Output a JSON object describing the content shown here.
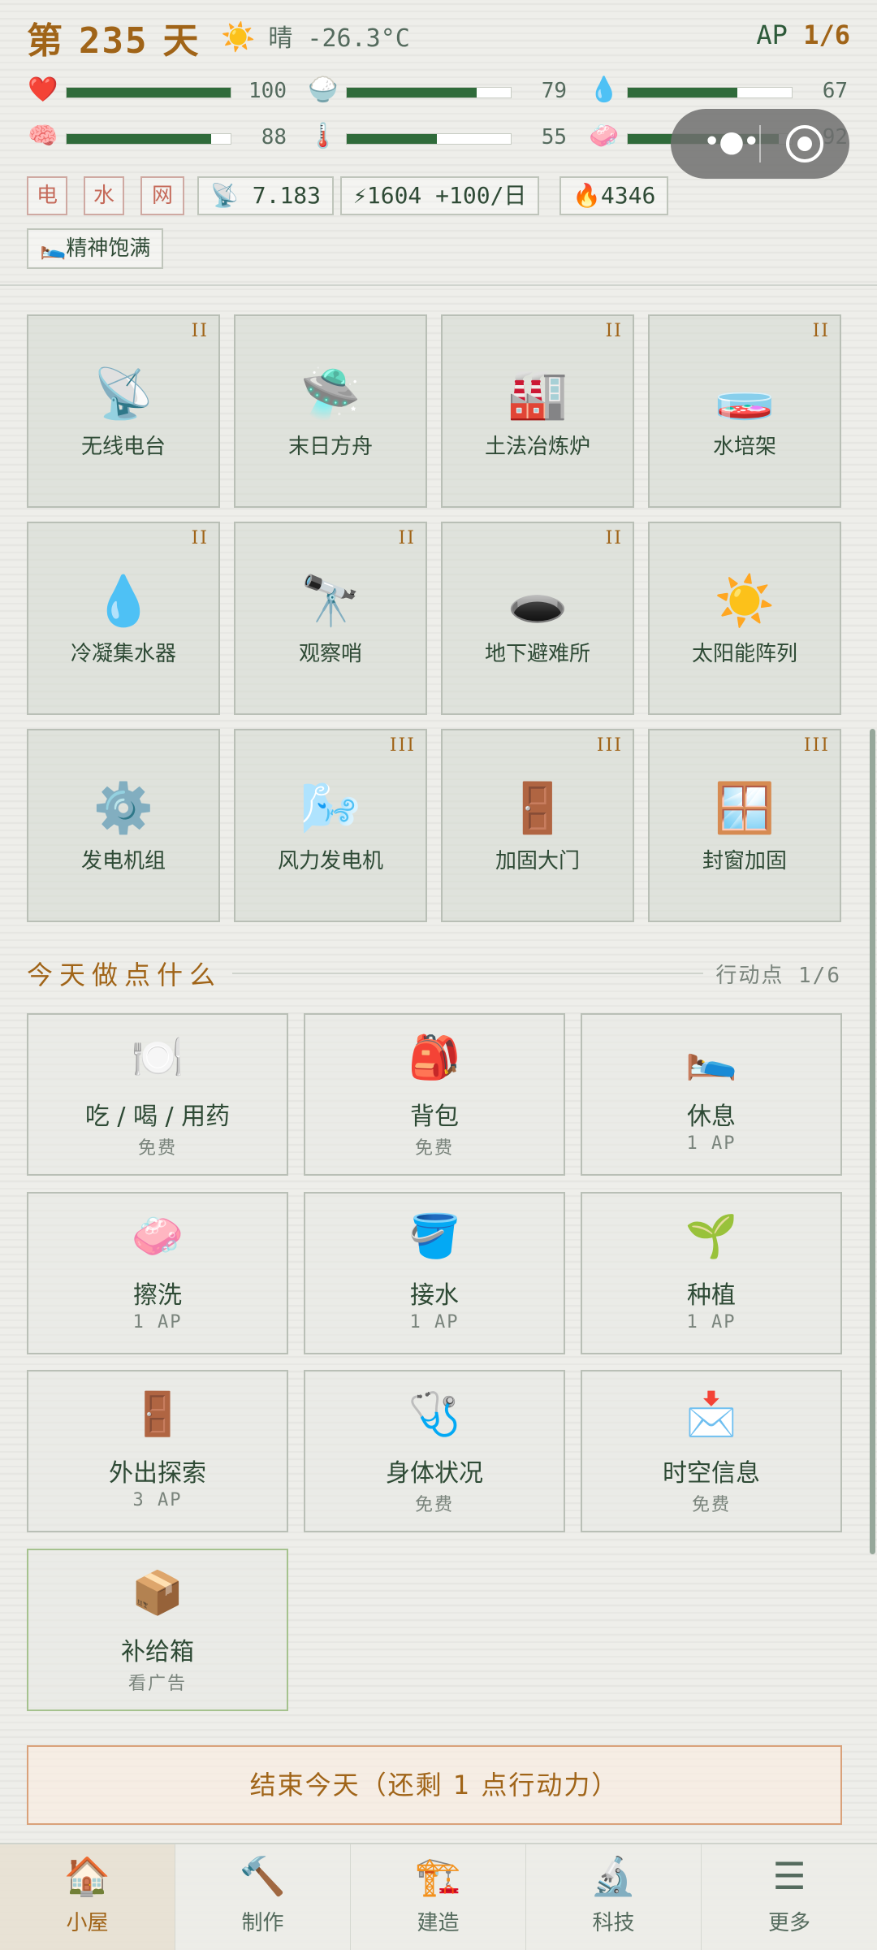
{
  "header": {
    "day_prefix": "第",
    "day_number": "235",
    "day_suffix": "天",
    "weather_icon": "☀️",
    "weather": "晴 -26.3°C",
    "ap_label": "AP",
    "ap_value": "1/6"
  },
  "stats": [
    {
      "icon": "❤️",
      "name": "heart",
      "value": 100,
      "fill": 1.0
    },
    {
      "icon": "🍚",
      "name": "rice-bowl",
      "value": 79,
      "fill": 0.79
    },
    {
      "icon": "💧",
      "name": "water-drop",
      "value": 67,
      "fill": 0.67
    },
    {
      "icon": "🧠",
      "name": "brain",
      "value": 88,
      "fill": 0.88
    },
    {
      "icon": "🌡️",
      "name": "thermometer",
      "value": 55,
      "fill": 0.55
    },
    {
      "icon": "🧼",
      "name": "soap",
      "value": 92,
      "fill": 0.92
    }
  ],
  "resources": {
    "power": "电",
    "water": "水",
    "net": "网",
    "signal_icon": "📡",
    "signal": "7.183",
    "energy_icon": "⚡",
    "energy": "1604 +100/日",
    "fire_icon": "🔥",
    "fire": "4346"
  },
  "status": {
    "icon": "🛌",
    "text": "精神饱满"
  },
  "buildings": [
    {
      "name": "无线电台",
      "level": "II",
      "icon": "📡"
    },
    {
      "name": "末日方舟",
      "level": "",
      "icon": "🛸"
    },
    {
      "name": "土法冶炼炉",
      "level": "II",
      "icon": "🏭"
    },
    {
      "name": "水培架",
      "level": "II",
      "icon": "🧫"
    },
    {
      "name": "冷凝集水器",
      "level": "II",
      "icon": "💧"
    },
    {
      "name": "观察哨",
      "level": "II",
      "icon": "🔭"
    },
    {
      "name": "地下避难所",
      "level": "II",
      "icon": "🕳️"
    },
    {
      "name": "太阳能阵列",
      "level": "",
      "icon": "☀️"
    },
    {
      "name": "发电机组",
      "level": "",
      "icon": "⚙️"
    },
    {
      "name": "风力发电机",
      "level": "III",
      "icon": "🌬️"
    },
    {
      "name": "加固大门",
      "level": "III",
      "icon": "🚪"
    },
    {
      "name": "封窗加固",
      "level": "III",
      "icon": "🪟"
    }
  ],
  "section": {
    "title": "今天做点什么",
    "right": "行动点 1/6"
  },
  "actions": [
    {
      "name": "吃 / 喝 / 用药",
      "cost": "免费",
      "icon": "🍽️"
    },
    {
      "name": "背包",
      "cost": "免费",
      "icon": "🎒"
    },
    {
      "name": "休息",
      "cost": "1 AP",
      "icon": "🛌"
    },
    {
      "name": "擦洗",
      "cost": "1 AP",
      "icon": "🧼"
    },
    {
      "name": "接水",
      "cost": "1 AP",
      "icon": "🪣"
    },
    {
      "name": "种植",
      "cost": "1 AP",
      "icon": "🌱"
    },
    {
      "name": "外出探索",
      "cost": "3 AP",
      "icon": "🚪"
    },
    {
      "name": "身体状况",
      "cost": "免费",
      "icon": "🩺"
    },
    {
      "name": "时空信息",
      "cost": "免费",
      "icon": "📩"
    },
    {
      "name": "补给箱",
      "cost": "看广告",
      "icon": "📦"
    }
  ],
  "end_button": "结束今天（还剩 1 点行动力）",
  "tabs": [
    {
      "label": "小屋",
      "icon": "🏠"
    },
    {
      "label": "制作",
      "icon": "🔨"
    },
    {
      "label": "建造",
      "icon": "🏗️"
    },
    {
      "label": "科技",
      "icon": "🔬"
    },
    {
      "label": "更多",
      "icon": "☰"
    }
  ],
  "colors": {
    "accent": "#a06418",
    "primary": "#2f6b3a",
    "background": "#eeeeea"
  }
}
